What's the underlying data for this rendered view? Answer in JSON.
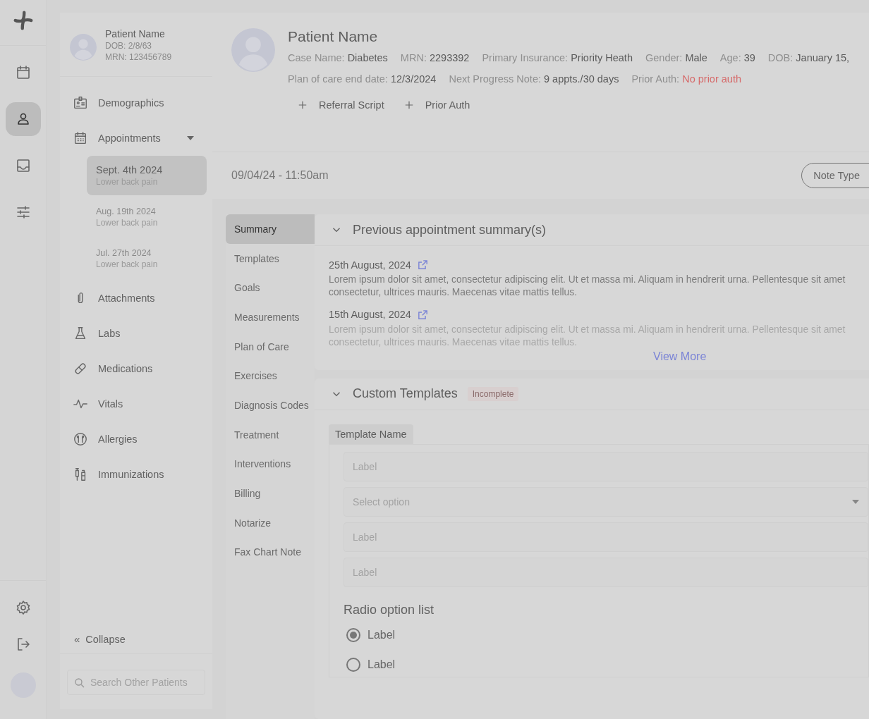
{
  "rail": {
    "top": [
      {
        "kind": "calendar",
        "selected": false
      },
      {
        "kind": "person",
        "selected": true
      },
      {
        "kind": "inbox",
        "selected": false
      },
      {
        "kind": "sliders",
        "selected": false
      }
    ],
    "bottom": [
      {
        "kind": "settings"
      },
      {
        "kind": "logout"
      },
      {
        "kind": "avatar"
      }
    ]
  },
  "patient_card": {
    "name": "Patient Name",
    "dob": "DOB: 2/8/63",
    "mrn": "MRN: 123456789"
  },
  "nav": [
    {
      "label": "Demographics"
    },
    {
      "label": "Appointments",
      "expanded": true,
      "children": [
        {
          "date": "Sept. 4th 2024",
          "reason": "Lower back pain",
          "selected": true
        },
        {
          "date": "Aug. 19th 2024",
          "reason": "Lower back pain",
          "selected": false
        },
        {
          "date": "Jul. 27th 2024",
          "reason": "Lower back pain",
          "selected": false
        }
      ]
    },
    {
      "label": "Attachments"
    },
    {
      "label": "Labs"
    },
    {
      "label": "Medications"
    },
    {
      "label": "Vitals"
    },
    {
      "label": "Allergies"
    },
    {
      "label": "Immunizations"
    }
  ],
  "collapse": {
    "icon": "«",
    "label": "Collapse"
  },
  "search": {
    "placeholder": "Search Other Patients"
  },
  "header": {
    "name": "Patient Name",
    "lines": [
      {
        "fields": [
          {
            "label": "Case Name:",
            "value": "Diabetes",
            "alert": false
          },
          {
            "label": "MRN:",
            "value": "2293392",
            "alert": false
          },
          {
            "label": "Primary Insurance:",
            "value": "Priority Heath",
            "alert": false
          },
          {
            "label": "Gender:",
            "value": "Male",
            "alert": false
          },
          {
            "label": "Age:",
            "value": "39",
            "alert": false
          },
          {
            "label": "DOB:",
            "value": "January 15,",
            "alert": false
          }
        ]
      },
      {
        "fields": [
          {
            "label": "Plan of care end date:",
            "value": "12/3/2024",
            "alert": false
          },
          {
            "label": "Next Progress Note:",
            "value": "9 appts./30 days",
            "alert": false
          },
          {
            "label": "Prior Auth:",
            "value": "No prior auth",
            "alert": true
          }
        ]
      }
    ],
    "actions": [
      "Referral Script",
      "Prior Auth"
    ]
  },
  "visit": {
    "datetime": "09/04/24 - 11:50am",
    "note_type": "Note Type"
  },
  "section_tabs": [
    {
      "label": "Summary",
      "selected": true
    },
    {
      "label": "Templates",
      "selected": false
    },
    {
      "label": "Goals",
      "selected": false
    },
    {
      "label": "Measurements",
      "selected": false
    },
    {
      "label": "Plan of Care",
      "selected": false
    },
    {
      "label": "Exercises",
      "selected": false
    },
    {
      "label": "Diagnosis Codes",
      "selected": false
    },
    {
      "label": "Treatment",
      "selected": false
    },
    {
      "label": "Interventions",
      "selected": false
    },
    {
      "label": "Billing",
      "selected": false
    },
    {
      "label": "Notarize",
      "selected": false
    },
    {
      "label": "Fax Chart Note",
      "selected": false
    }
  ],
  "previous": {
    "title": "Previous appointment summary(s)",
    "expanded": true,
    "entries": [
      {
        "date": "25th August, 2024",
        "text": "Lorem ipsum dolor sit amet, consectetur adipiscing elit. Ut et massa mi. Aliquam in hendrerit urna. Pellentesque sit amet consectetur, ultrices mauris. Maecenas vitae mattis tellus.",
        "faded": false
      },
      {
        "date": "15th August, 2024",
        "text": "Lorem ipsum dolor sit amet, consectetur adipiscing elit. Ut et massa mi. Aliquam in hendrerit urna. Pellentesque sit amet consectetur, ultrices mauris. Maecenas vitae mattis tellus.",
        "faded": true
      }
    ],
    "view_more": "View More"
  },
  "custom": {
    "title": "Custom Templates",
    "badge": "Incomplete",
    "expanded": true,
    "template_tab": "Template Name",
    "fields": [
      {
        "kind": "text",
        "placeholder": "Label"
      },
      {
        "kind": "select",
        "placeholder": "Select option"
      },
      {
        "kind": "text",
        "placeholder": "Label"
      },
      {
        "kind": "text",
        "placeholder": "Label"
      }
    ],
    "radio_title": "Radio option list",
    "options": [
      {
        "label": "Label",
        "selected": true
      },
      {
        "label": "Label",
        "selected": false
      }
    ]
  }
}
